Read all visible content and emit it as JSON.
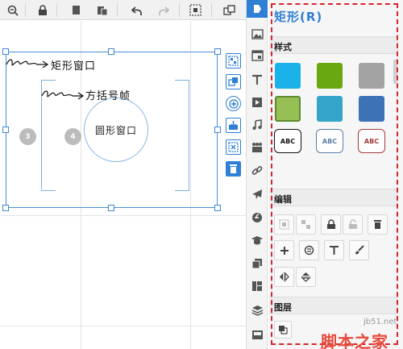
{
  "canvas": {
    "annotations": {
      "rect_window": "矩形窗口",
      "bracket_frame": "方括号帧",
      "circle_window": "圆形窗口"
    },
    "badges": [
      "3",
      "4"
    ]
  },
  "panel": {
    "title": "矩形(R)",
    "sections": {
      "style": "样式",
      "edit": "编辑",
      "layer": "图层"
    },
    "swatches": [
      {
        "color": "#1ab2e8",
        "kind": "fill"
      },
      {
        "color": "#6aa812",
        "kind": "fill"
      },
      {
        "color": "#a3a3a3",
        "kind": "fill"
      },
      {
        "color": "#96bf55",
        "kind": "fill-border",
        "border": "#5d8a2c"
      },
      {
        "color": "#34a5c9",
        "kind": "fill"
      },
      {
        "color": "#3b73b6",
        "kind": "fill"
      },
      {
        "label": "ABC",
        "kind": "text",
        "border": "#111111"
      },
      {
        "label": "ABC",
        "kind": "text",
        "border": "#5b7ea6"
      },
      {
        "label": "ABC",
        "kind": "text",
        "border": "#a33a3a"
      }
    ]
  },
  "watermark": {
    "site": "jb51.net",
    "brand": "脚本之家"
  },
  "colors": {
    "accent": "#2e7fd6",
    "highlight_frame": "#d8262b",
    "selection": "#4a8fd8"
  }
}
